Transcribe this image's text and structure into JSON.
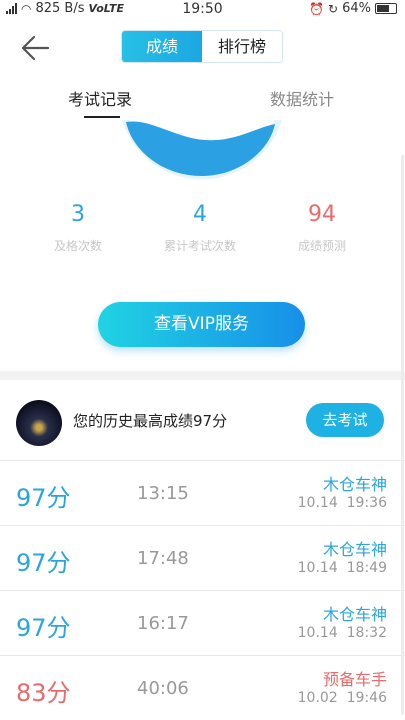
{
  "status_bar": {
    "network_speed": "825 B/s",
    "carrier_tech": "VoLTE",
    "time": "19:50",
    "battery": "64%"
  },
  "header": {
    "segments": [
      {
        "label": "成绩",
        "active": true
      },
      {
        "label": "排行榜",
        "active": false
      }
    ],
    "tabs": [
      {
        "label": "考试记录",
        "active": true
      },
      {
        "label": "数据统计",
        "active": false
      }
    ]
  },
  "stats": [
    {
      "value": "3",
      "label": "及格次数",
      "color": "#2aa5dd"
    },
    {
      "value": "4",
      "label": "累计考试次数",
      "color": "#2aa5dd"
    },
    {
      "value": "94",
      "label": "成绩预测",
      "color": "#e86b6b"
    }
  ],
  "vip_button": "查看VIP服务",
  "best": {
    "text": "您的历史最高成绩97分",
    "button": "去考试"
  },
  "records": [
    {
      "score": "97分",
      "duration": "13:15",
      "level": "木仓车神",
      "date": "10.14",
      "time": "19:36",
      "score_color": "#2aa5dd",
      "level_color": "#2aa5dd"
    },
    {
      "score": "97分",
      "duration": "17:48",
      "level": "木仓车神",
      "date": "10.14",
      "time": "18:49",
      "score_color": "#2aa5dd",
      "level_color": "#2aa5dd"
    },
    {
      "score": "97分",
      "duration": "16:17",
      "level": "木仓车神",
      "date": "10.14",
      "time": "18:32",
      "score_color": "#2aa5dd",
      "level_color": "#2aa5dd"
    },
    {
      "score": "83分",
      "duration": "40:06",
      "level": "预备车手",
      "date": "10.02",
      "time": "19:46",
      "score_color": "#e86b6b",
      "level_color": "#e86b6b"
    }
  ]
}
